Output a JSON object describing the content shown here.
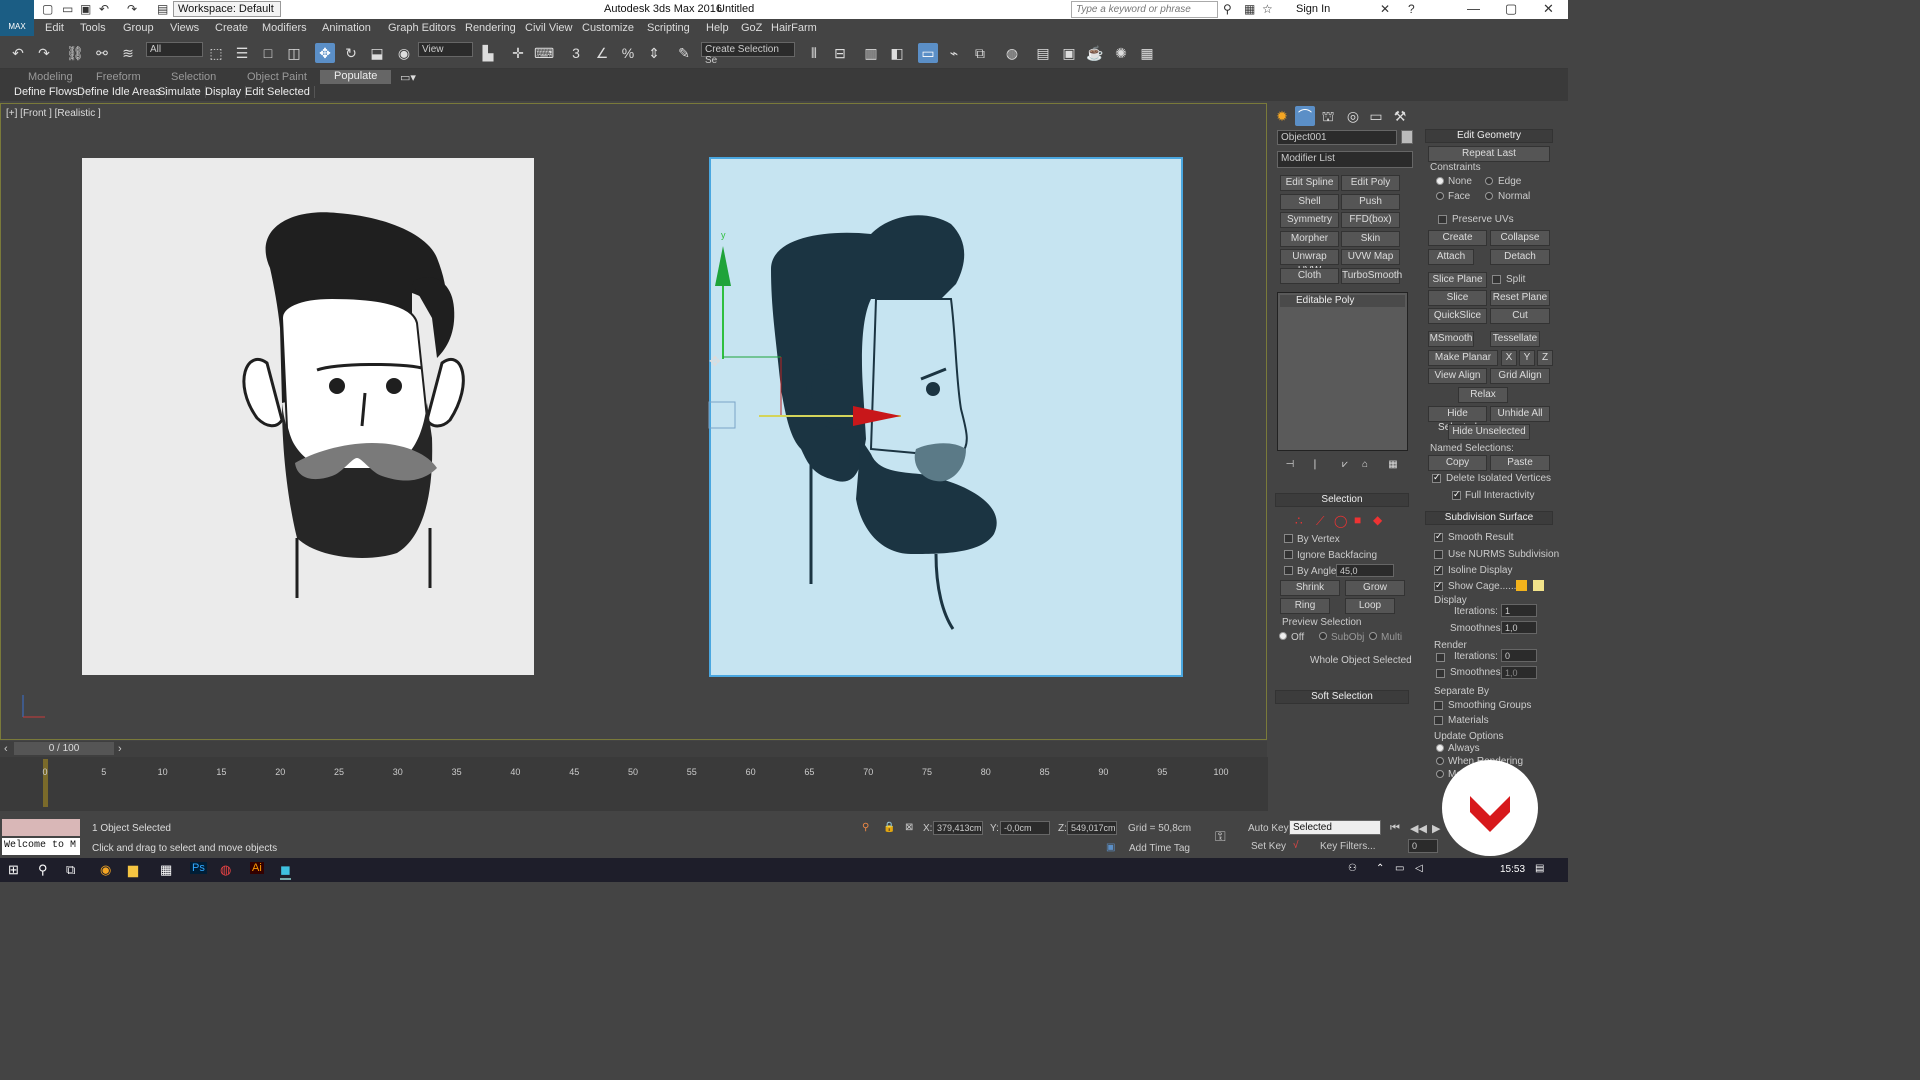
{
  "app": {
    "title": "Autodesk 3ds Max 2016",
    "doc": "Untitled",
    "logo": "MAX",
    "workspace": "Workspace: Default",
    "search_placeholder": "Type a keyword or phrase",
    "sign_in": "Sign In"
  },
  "menu": [
    "Edit",
    "Tools",
    "Group",
    "Views",
    "Create",
    "Modifiers",
    "Animation",
    "Graph Editors",
    "Rendering",
    "Civil View",
    "Customize",
    "Scripting",
    "Help",
    "GoZ",
    "HairFarm"
  ],
  "toolbar": {
    "filter": "All",
    "ref_coord": "View",
    "selection_set": "Create Selection Se"
  },
  "ribbon": {
    "tabs": [
      "Modeling",
      "Freeform",
      "Selection",
      "Object Paint",
      "Populate"
    ],
    "active_tab": "Populate",
    "subtabs": [
      "Define Flows",
      "Define Idle Areas",
      "Simulate",
      "Display",
      "Edit Selected"
    ]
  },
  "viewport": {
    "label": "[+] [Front ] [Realistic ]",
    "gizmo_y": "y"
  },
  "cmd": {
    "object_name": "Object001",
    "modifier_list": "Modifier List",
    "modifier_buttons": [
      "Edit Spline",
      "Edit Poly",
      "Shell",
      "Push",
      "Symmetry",
      "FFD(box)",
      "Morpher",
      "Skin",
      "Unwrap UVW",
      "UVW Map",
      "Cloth",
      "TurboSmooth"
    ],
    "stack_item": "Editable Poly",
    "selection": {
      "header": "Selection",
      "by_vertex": "By Vertex",
      "ignore_backfacing": "Ignore Backfacing",
      "by_angle": "By Angle:",
      "angle": "45,0",
      "shrink": "Shrink",
      "grow": "Grow",
      "ring": "Ring",
      "loop": "Loop",
      "preview": "Preview Selection",
      "off": "Off",
      "subobj": "SubObj",
      "multi": "Multi",
      "status": "Whole Object Selected"
    },
    "soft_selection": "Soft Selection"
  },
  "edit_geometry": {
    "header": "Edit Geometry",
    "repeat_last": "Repeat Last",
    "constraints": "Constraints",
    "none": "None",
    "edge": "Edge",
    "face": "Face",
    "normal": "Normal",
    "preserve_uvs": "Preserve UVs",
    "create": "Create",
    "collapse": "Collapse",
    "attach": "Attach",
    "detach": "Detach",
    "slice_plane": "Slice Plane",
    "split": "Split",
    "slice": "Slice",
    "reset_plane": "Reset Plane",
    "quickslice": "QuickSlice",
    "cut": "Cut",
    "msmooth": "MSmooth",
    "tessellate": "Tessellate",
    "make_planar": "Make Planar",
    "x": "X",
    "y": "Y",
    "z": "Z",
    "view_align": "View Align",
    "grid_align": "Grid Align",
    "relax": "Relax",
    "hide_selected": "Hide Selected",
    "unhide_all": "Unhide All",
    "hide_unselected": "Hide Unselected",
    "named_selections": "Named Selections:",
    "copy": "Copy",
    "paste": "Paste",
    "delete_isolated": "Delete Isolated Vertices",
    "full_interactivity": "Full Interactivity"
  },
  "subdiv": {
    "header": "Subdivision Surface",
    "smooth_result": "Smooth Result",
    "use_nurms": "Use NURMS Subdivision",
    "isoline": "Isoline Display",
    "show_cage": "Show Cage......",
    "display": "Display",
    "iterations": "Iterations:",
    "iter_display": "1",
    "smoothness": "Smoothness:",
    "smooth_display": "1,0",
    "render": "Render",
    "iter_render": "0",
    "smooth_render": "1,0",
    "separate_by": "Separate By",
    "smoothing_groups": "Smoothing Groups",
    "materials": "Materials",
    "update_options": "Update Options",
    "always": "Always",
    "when_rendering": "When Rendering",
    "manually": "Manually"
  },
  "timeline": {
    "frame": "0 / 100",
    "ticks": [
      "0",
      "5",
      "10",
      "15",
      "20",
      "25",
      "30",
      "35",
      "40",
      "45",
      "50",
      "55",
      "60",
      "65",
      "70",
      "75",
      "80",
      "85",
      "90",
      "95",
      "100"
    ]
  },
  "status": {
    "objects": "1 Object Selected",
    "prompt": "Click and drag to select and move objects",
    "welcome": "Welcome to M",
    "x_label": "X:",
    "x": "379,413cm",
    "y_label": "Y:",
    "y": "-0,0cm",
    "z_label": "Z:",
    "z": "549,017cm",
    "grid": "Grid = 50,8cm",
    "add_time_tag": "Add Time Tag",
    "auto_key": "Auto Key",
    "set_key": "Set Key",
    "selected": "Selected",
    "key_filters": "Key Filters...",
    "frame_field": "0"
  },
  "taskbar": {
    "time": "15:53"
  },
  "colors": {
    "accent": "#5b8fc7",
    "selection_border": "#4aa7e0",
    "plane_blue": "#c6e4f1",
    "beard_dark": "#1b3442",
    "brand_red": "#d7191c"
  }
}
